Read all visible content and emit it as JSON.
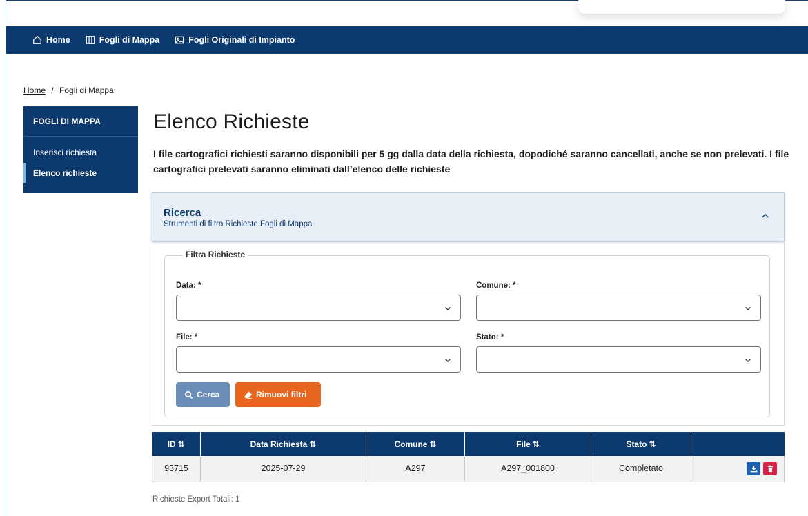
{
  "nav": {
    "items": [
      {
        "label": "Home",
        "icon": "home-icon"
      },
      {
        "label": "Fogli di Mappa",
        "icon": "columns-icon"
      },
      {
        "label": "Fogli Originali di Impianto",
        "icon": "image-icon"
      }
    ]
  },
  "breadcrumb": {
    "home": "Home",
    "separator": "/",
    "current": "Fogli di Mappa"
  },
  "sidebar": {
    "title": "FOGLI DI MAPPA",
    "items": [
      {
        "label": "Inserisci richiesta",
        "active": false
      },
      {
        "label": "Elenco richieste",
        "active": true
      }
    ]
  },
  "page": {
    "title": "Elenco Richieste",
    "intro": "I file cartografici richiesti saranno disponibili per 5 gg dalla data della richiesta, dopodiché saranno cancellati, anche se non prelevati. I file cartografici prelevati saranno eliminati dall’elenco delle richieste"
  },
  "search": {
    "title": "Ricerca",
    "subtitle": "Strumenti di filtro Richieste Fogli di Mappa",
    "legend": "Filtra Richieste",
    "fields": {
      "data": {
        "label": "Data: *",
        "value": ""
      },
      "comune": {
        "label": "Comune: *",
        "value": ""
      },
      "file": {
        "label": "File: *",
        "value": ""
      },
      "stato": {
        "label": "Stato: *",
        "value": ""
      }
    },
    "search_button": "Cerca",
    "clear_button": "Rimuovi filtri"
  },
  "table": {
    "headers": [
      "ID",
      "Data Richiesta",
      "Comune",
      "File",
      "Stato",
      ""
    ],
    "sort_glyph": "⇅",
    "rows": [
      {
        "id": "93715",
        "data": "2025-07-29",
        "comune": "A297",
        "file": "A297_001800",
        "stato": "Completato"
      }
    ],
    "total": "Richieste Export Totali: 1"
  },
  "colors": {
    "primary": "#0d3a6e",
    "accent_orange": "#e8651e",
    "search_button": "#6a8db7",
    "download": "#1f5fb0",
    "delete": "#d32346"
  }
}
